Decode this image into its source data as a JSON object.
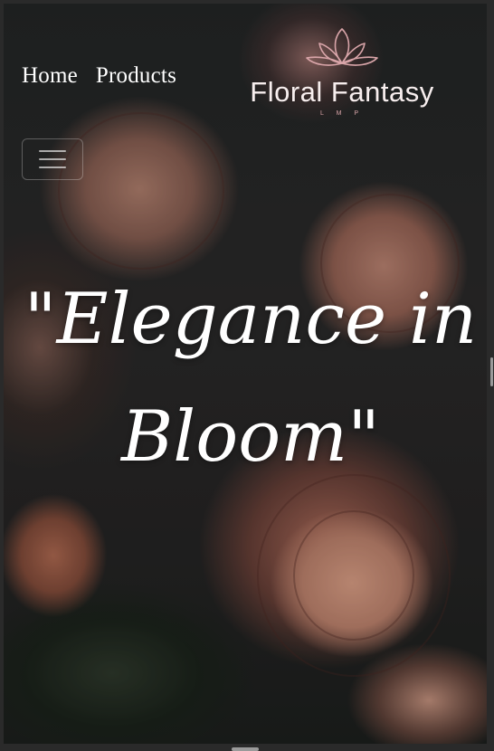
{
  "nav": {
    "items": [
      {
        "label": "Home"
      },
      {
        "label": "Products"
      }
    ]
  },
  "logo": {
    "name": "Floral Fantasy",
    "tagline": "L M P",
    "icon": "lotus-icon",
    "accent_color": "#d9a5a9"
  },
  "menu_toggle": {
    "icon": "hamburger-icon"
  },
  "hero": {
    "title": "\"Elegance in Bloom\""
  }
}
